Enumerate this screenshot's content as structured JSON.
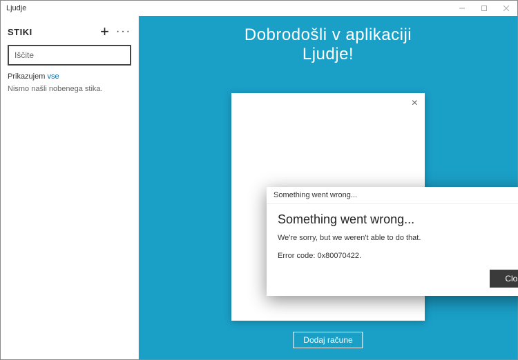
{
  "window": {
    "title": "Ljudje"
  },
  "sidebar": {
    "title": "STIKI",
    "search_placeholder": "Iščite",
    "filter_prefix": "Prikazujem ",
    "filter_value": "vse",
    "empty_message": "Nismo našli nobenega stika."
  },
  "main": {
    "welcome_line1": "Dobrodošli v aplikaciji",
    "welcome_line2": "Ljudje!",
    "add_accounts_label": "Dodaj račune"
  },
  "error_dialog": {
    "titlebar": "Something went wrong...",
    "heading": "Something went wrong...",
    "message": "We're sorry, but we weren't able to do that.",
    "code_label": "Error code: 0x80070422.",
    "close_label": "Close"
  }
}
